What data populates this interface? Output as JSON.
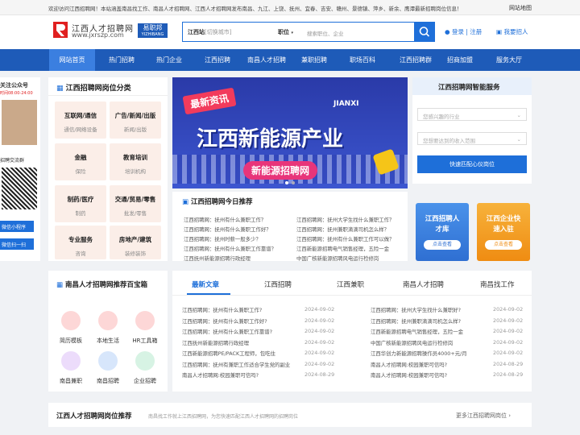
{
  "topbar": {
    "message": "欢迎访问江西招聘网！本站涵盖南昌找工作、南昌人才招聘网、江西人才招聘网发布南昌、九江、上饶、抚州、宜春、吉安、赣州、景德镇、萍乡、新余、鹰潭最新招聘岗位信息！",
    "sitemap": "网站地图"
  },
  "logo": {
    "title": "江西人才招聘网",
    "url": "www.jxrszp.com",
    "badge": "易职邦",
    "badge_sub": "YIZHIBANG"
  },
  "search": {
    "city_label": "江西站",
    "city_hint": "[切换城市]",
    "position_label": "职位",
    "placeholder": "搜索职位、企业"
  },
  "account": {
    "login": "登录",
    "sep": "|",
    "register": "注册",
    "hire": "我要招人"
  },
  "nav": [
    "网站首页",
    "热门招聘",
    "热门企业",
    "江西招聘",
    "南昌人才招聘",
    "兼职招聘",
    "职场百科",
    "江西招聘群",
    "招商加盟",
    "服务大厅"
  ],
  "left_sidebar": {
    "follow": "关注公众号",
    "time": "时间08:00-24:00",
    "group": "招聘交流群",
    "mini": "微信小程序",
    "scan": "微信扫一扫"
  },
  "categories": {
    "title": "江西招聘网岗位分类",
    "items": [
      {
        "title": "互联网/通信",
        "sub": "通信/网络设备"
      },
      {
        "title": "广告/新闻/出版",
        "sub": "新闻/出版"
      },
      {
        "title": "金融",
        "sub": "保险"
      },
      {
        "title": "教育培训",
        "sub": "培训机构"
      },
      {
        "title": "制药/医疗",
        "sub": "制药"
      },
      {
        "title": "交通/贸易/零售",
        "sub": "批发/零售"
      },
      {
        "title": "专业服务",
        "sub": "咨询"
      },
      {
        "title": "房地产/建筑",
        "sub": "装修装饰"
      }
    ]
  },
  "banner": {
    "tag": "最新资讯",
    "region": "JIANXI",
    "headline": "江西新能源产业",
    "sub": "新能源招聘网"
  },
  "recommend": {
    "title": "江西招聘网今日推荐",
    "left": [
      "江西招聘网：抚州有什么兼职工作？",
      "江西招聘网：抚州有什么兼职工作好？",
      "江西招聘网：抚州时薪一般多少？",
      "江西招聘网：抚州有什么兼职工作靠谱？",
      "江西抚州新能源招聘行政经理",
      "江西新能源招聘PE/PACK工程师，包吃住"
    ],
    "right": [
      "江西招聘网：抚州大学生找什么兼职工作？",
      "江西招聘网：抚州兼职滴滴司机怎么样？",
      "江西招聘网：抚州有什么兼职工作可以做？",
      "江西新能源招聘电气销售经理，五险一金",
      "中国广核新能源招聘风电运行检修岗",
      "江西华创力新能源招聘操作员4000+元/月"
    ]
  },
  "smart": {
    "title": "江西招聘网智能服务",
    "industry_ph": "您感兴趣的行业",
    "salary_ph": "您想要达到的收入范围",
    "button": "快速匹配心仪岗位",
    "talent": "江西招聘人才库",
    "talent_btn": "点击查看",
    "company": "江西企业快速入驻",
    "company_btn": "点击查看"
  },
  "toolbox": {
    "title": "南昌人才招聘网推荐百宝箱",
    "items": [
      "简历模板",
      "本地生活",
      "HR工具箱",
      "南昌兼职",
      "南昌招聘",
      "企业招聘"
    ]
  },
  "tabs": [
    "最新文章",
    "江西招聘",
    "江西兼职",
    "南昌人才招聘",
    "南昌找工作"
  ],
  "articles": {
    "left": [
      {
        "t": "江西招聘网：抚州有什么兼职工作?",
        "d": "2024-09-02"
      },
      {
        "t": "江西招聘网：抚州有什么兼职工作好?",
        "d": "2024-09-02"
      },
      {
        "t": "江西招聘网：抚州有什么兼职工作靠谱?",
        "d": "2024-09-02"
      },
      {
        "t": "江西抚州新能源招聘行政经理",
        "d": "2024-09-02"
      },
      {
        "t": "江西新能源招聘PE/PACK工程师，包吃住",
        "d": "2024-09-02"
      },
      {
        "t": "江西招聘网：抚州有兼职工作适合学生党的副业",
        "d": "2024-09-02"
      },
      {
        "t": "南昌人才招聘网:校园兼职可信吗?",
        "d": "2024-08-29"
      }
    ],
    "right": [
      {
        "t": "江西招聘网：抚州大学生找什么兼职好?",
        "d": "2024-09-02"
      },
      {
        "t": "江西招聘网：抚州兼职滴滴司机怎么样?",
        "d": "2024-09-02"
      },
      {
        "t": "江西新能源招聘电气销售经理，五险一金",
        "d": "2024-09-02"
      },
      {
        "t": "中国广核新能源招聘风电运行检修岗",
        "d": "2024-09-02"
      },
      {
        "t": "江西华创力新能源招聘操作员4000+元/月",
        "d": "2024-09-02"
      },
      {
        "t": "南昌人才招聘网:校园兼职可信吗?",
        "d": "2024-08-29"
      },
      {
        "t": "南昌人才招聘网:校园兼职可信吗?",
        "d": "2024-08-29"
      }
    ]
  },
  "bottom": {
    "title": "江西人才招聘网岗位推荐",
    "desc": "南昌找工作就上江西招聘网，为您快速匹配江西人才招聘网的招聘岗位",
    "more": "更多江西招聘网岗位"
  },
  "colors": {
    "primary": "#1e5bb8",
    "accent": "#1e6fd9",
    "orange": "#f39c12",
    "red": "#e02020"
  }
}
